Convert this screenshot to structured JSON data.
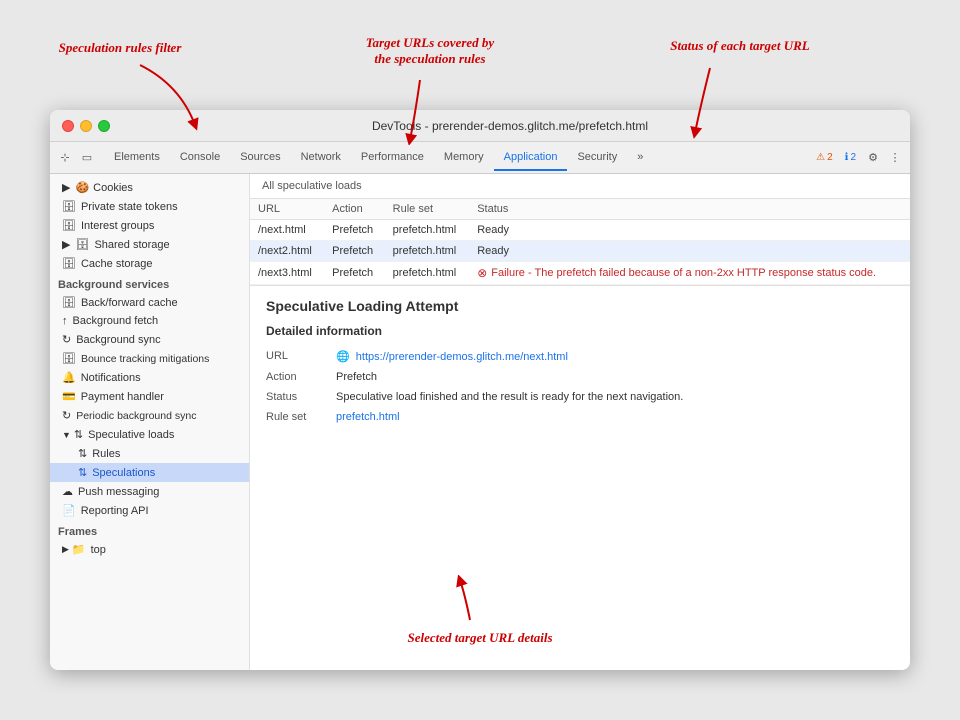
{
  "annotations": {
    "speculation_rules_filter": "Speculation rules filter",
    "target_urls": "Target URLs covered by\nthe speculation rules",
    "status_each": "Status of each target URL",
    "selected_details": "Selected target URL details"
  },
  "browser": {
    "title": "DevTools - prerender-demos.glitch.me/prefetch.html"
  },
  "devtools": {
    "tabs": [
      {
        "label": "Elements",
        "active": false
      },
      {
        "label": "Console",
        "active": false
      },
      {
        "label": "Sources",
        "active": false
      },
      {
        "label": "Network",
        "active": false
      },
      {
        "label": "Performance",
        "active": false
      },
      {
        "label": "Memory",
        "active": false
      },
      {
        "label": "Application",
        "active": true
      },
      {
        "label": "Security",
        "active": false
      },
      {
        "label": "»",
        "active": false
      }
    ],
    "badges": {
      "warn_count": "2",
      "info_count": "2"
    }
  },
  "sidebar": {
    "sections": [
      {
        "items": [
          {
            "label": "Cookies",
            "icon": "▶ 🍪",
            "indent": 0
          },
          {
            "label": "Private state tokens",
            "icon": "🗄",
            "indent": 0
          },
          {
            "label": "Interest groups",
            "icon": "🗄",
            "indent": 0
          },
          {
            "label": "Shared storage",
            "icon": "▶ 🗄",
            "indent": 0
          },
          {
            "label": "Cache storage",
            "icon": "🗄",
            "indent": 0
          }
        ]
      },
      {
        "group": "Background services",
        "items": [
          {
            "label": "Back/forward cache",
            "icon": "🗄",
            "indent": 0
          },
          {
            "label": "Background fetch",
            "icon": "↑",
            "indent": 0
          },
          {
            "label": "Background sync",
            "icon": "↻",
            "indent": 0
          },
          {
            "label": "Bounce tracking mitigations",
            "icon": "🗄",
            "indent": 0
          },
          {
            "label": "Notifications",
            "icon": "🔔",
            "indent": 0
          },
          {
            "label": "Payment handler",
            "icon": "💳",
            "indent": 0
          },
          {
            "label": "Periodic background sync",
            "icon": "↻",
            "indent": 0
          },
          {
            "label": "Speculative loads",
            "icon": "▼ ↑↓",
            "indent": 0,
            "active": true
          },
          {
            "label": "Rules",
            "icon": "↑↓",
            "indent": 1
          },
          {
            "label": "Speculations",
            "icon": "↑↓",
            "indent": 1,
            "selected": true
          },
          {
            "label": "Push messaging",
            "icon": "☁",
            "indent": 0
          },
          {
            "label": "Reporting API",
            "icon": "📄",
            "indent": 0
          }
        ]
      },
      {
        "group": "Frames",
        "items": [
          {
            "label": "top",
            "icon": "▶ 📁",
            "indent": 0
          }
        ]
      }
    ]
  },
  "main": {
    "panel_header": "All speculative loads",
    "table": {
      "columns": [
        "URL",
        "Action",
        "Rule set",
        "Status"
      ],
      "rows": [
        {
          "url": "/next.html",
          "action": "Prefetch",
          "rule_set": "prefetch.html",
          "status": "Ready",
          "error": false,
          "selected": false
        },
        {
          "url": "/next2.html",
          "action": "Prefetch",
          "rule_set": "prefetch.html",
          "status": "Ready",
          "error": false,
          "selected": true
        },
        {
          "url": "/next3.html",
          "action": "Prefetch",
          "rule_set": "prefetch.html",
          "status": "Failure - The prefetch failed because of a non-2xx HTTP response status code.",
          "error": true,
          "selected": false
        }
      ]
    },
    "detail": {
      "title": "Speculative Loading Attempt",
      "subtitle": "Detailed information",
      "rows": [
        {
          "label": "URL",
          "value": "https://prerender-demos.glitch.me/next.html",
          "is_link": true
        },
        {
          "label": "Action",
          "value": "Prefetch",
          "is_link": false
        },
        {
          "label": "Status",
          "value": "Speculative load finished and the result is ready for the next navigation.",
          "is_link": false
        },
        {
          "label": "Rule set",
          "value": "prefetch.html",
          "is_link": true
        }
      ]
    }
  }
}
